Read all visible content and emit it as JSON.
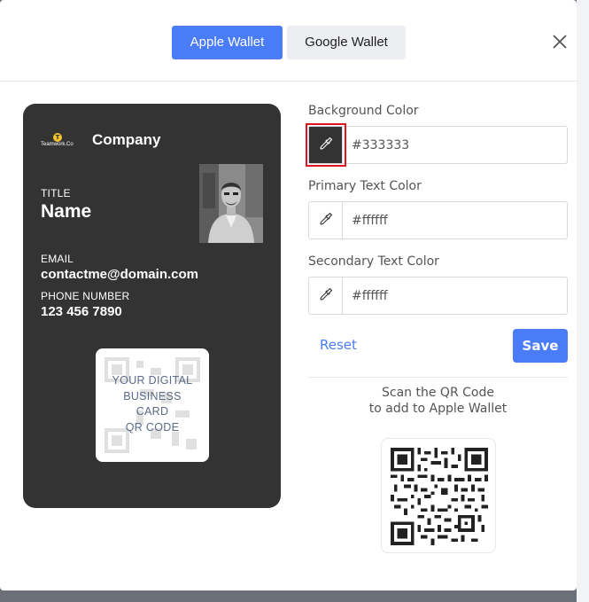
{
  "tabs": {
    "apple": "Apple Wallet",
    "google": "Google Wallet"
  },
  "card": {
    "logo_text": "Teamwork.Co",
    "logo_initial": "T",
    "company": "Company",
    "title_label": "TITLE",
    "name": "Name",
    "email_label": "EMAIL",
    "email": "contactme@domain.com",
    "phone_label": "PHONE NUMBER",
    "phone": "123 456 7890",
    "qr_caption_1": "YOUR DIGITAL",
    "qr_caption_2": "BUSINESS",
    "qr_caption_3": "CARD",
    "qr_caption_4": "QR CODE",
    "background": "#333333"
  },
  "form": {
    "background_label": "Background Color",
    "background_value": "#333333",
    "primary_label": "Primary Text Color",
    "primary_value": "#ffffff",
    "secondary_label": "Secondary Text Color",
    "secondary_value": "#ffffff",
    "reset": "Reset",
    "save": "Save"
  },
  "scan": {
    "line1": "Scan the QR Code",
    "line2": "to add to Apple Wallet"
  },
  "colors": {
    "accent": "#4a7cf7",
    "highlight": "#e0141e"
  },
  "icons": {
    "close": "close-icon",
    "picker": "eyedropper-icon",
    "logo": "teamwork-logo"
  }
}
